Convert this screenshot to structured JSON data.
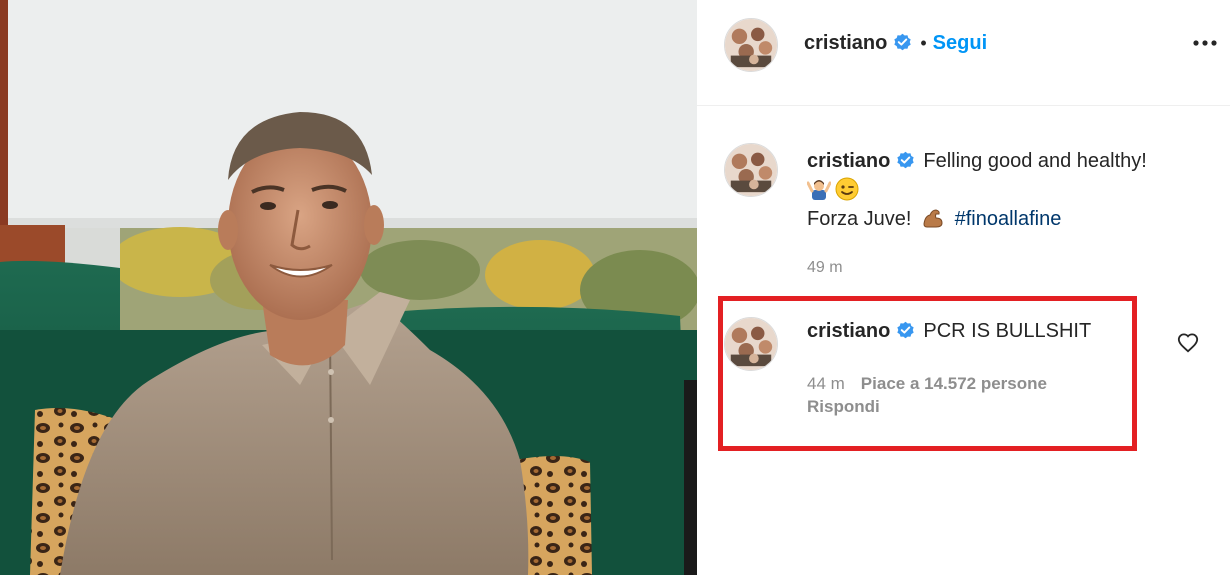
{
  "post": {
    "username": "cristiano",
    "follow_separator": "•",
    "follow_label": "Segui",
    "more_icon": "more-options-icon",
    "photo_subject": "photo"
  },
  "caption": {
    "username": "cristiano",
    "line1": "Felling good and healthy!",
    "emojis_line2": [
      "person-gesturing-icon",
      "winking-face-icon"
    ],
    "line3_text": "Forza Juve!",
    "line3_emoji": "flexed-biceps-icon",
    "hashtag": "#fino​alla​fine",
    "time": "49 m"
  },
  "comment": {
    "username": "cristiano",
    "text": "PCR IS BULLSHIT",
    "time": "44 m",
    "likes": "Piace a 14.572 persone",
    "reply_label": "Rispondi",
    "like_icon": "heart-icon"
  },
  "colors": {
    "follow_blue": "#0095f6",
    "verified_blue": "#3897f0",
    "highlight_red": "#e32023",
    "meta_gray": "#8e8e8e",
    "hashtag_navy": "#00376b"
  }
}
